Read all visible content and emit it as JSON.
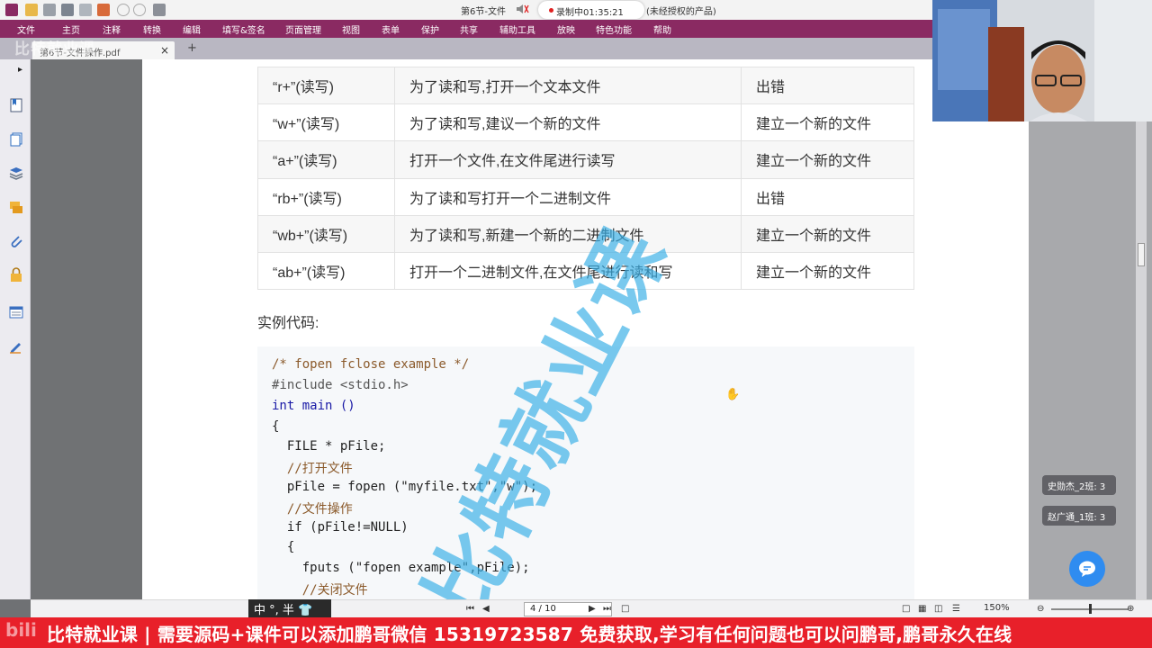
{
  "app": {
    "doc_title": "第6节-文件",
    "rec_status": "录制中01:35:21",
    "title_suffix": "(未经授权的产品)"
  },
  "menu": {
    "items": [
      "文件",
      "主页",
      "注释",
      "转换",
      "编辑",
      "填写&签名",
      "页面管理",
      "视图",
      "表单",
      "保护",
      "共享",
      "辅助工具",
      "放映",
      "特色功能",
      "帮助"
    ]
  },
  "tab": {
    "label": "第6节-文件操作.pdf",
    "close": "×",
    "add": "+"
  },
  "watermark": {
    "logo": "比特就业课",
    "text": "比特就业课"
  },
  "table": {
    "rows": [
      [
        "“r+”(读写)",
        "为了读和写,打开一个文本文件",
        "出错"
      ],
      [
        "“w+”(读写)",
        "为了读和写,建议一个新的文件",
        "建立一个新的文件"
      ],
      [
        "“a+”(读写)",
        "打开一个文件,在文件尾进行读写",
        "建立一个新的文件"
      ],
      [
        "“rb+”(读写)",
        "为了读和写打开一个二进制文件",
        "出错"
      ],
      [
        "“wb+”(读写)",
        "为了读和写,新建一个新的二进制文件",
        "建立一个新的文件"
      ],
      [
        "“ab+”(读写)",
        "打开一个二进制文件,在文件尾进行读和写",
        "建立一个新的文件"
      ]
    ]
  },
  "code": {
    "heading": "实例代码:",
    "lines": [
      "/* fopen fclose example */",
      "#include <stdio.h>",
      "int main ()",
      "{",
      "  FILE * pFile;",
      "  //打开文件",
      "  pFile = fopen (\"myfile.txt\",\"w\");",
      "  //文件操作",
      "  if (pFile!=NULL)",
      "  {",
      "    fputs (\"fopen example\",pFile);",
      "    //关闭文件"
    ]
  },
  "chat": {
    "badge1": "史勋杰_2班: 3",
    "badge2": "赵广通_1班: 3"
  },
  "statusbar": {
    "page": "4 / 10",
    "zoom": "150%",
    "ime": "中 °, 半 👕"
  },
  "banner": {
    "text": "比特就业课 | 需要源码+课件可以添加鹏哥微信 15319723587 免费获取,学习有任何问题也可以问鹏哥,鹏哥永久在线",
    "logo": "bili"
  },
  "colors": {
    "menubar": "#8a2a62",
    "banner": "#e8202a",
    "watermark": "#3aafe6",
    "chat_button": "#2f8cf0"
  },
  "icons": [
    "pdf-app-icon",
    "open-icon",
    "save-icon",
    "print-icon",
    "undo-icon",
    "redo-icon",
    "speaker-icon",
    "bookmark-icon",
    "pages-icon",
    "layers-icon",
    "comments-icon",
    "attachment-icon",
    "lock-icon",
    "fields-icon",
    "signature-icon",
    "chat-icon",
    "hand-cursor-icon"
  ]
}
